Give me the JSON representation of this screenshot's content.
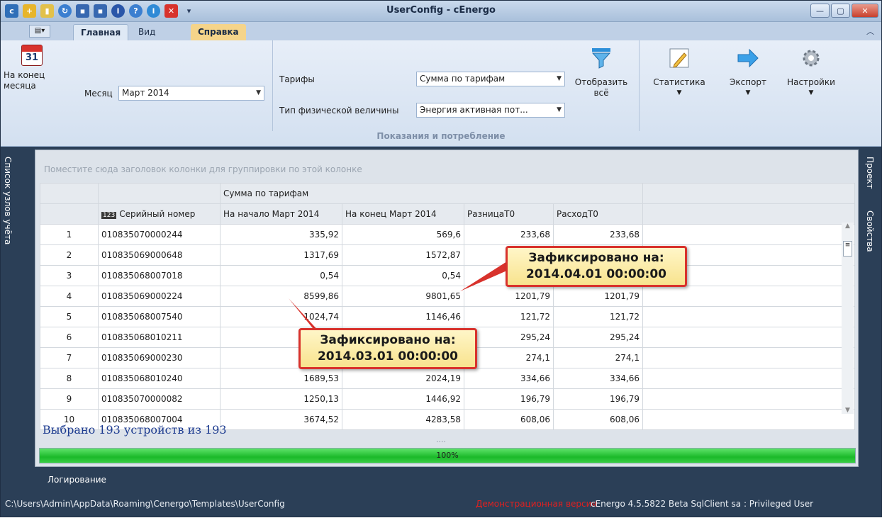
{
  "window": {
    "title": "UserConfig - cEnergo",
    "qat_icons": [
      "app-logo-icon",
      "add-icon",
      "book-icon",
      "refresh-icon",
      "save-icon",
      "save-as-icon",
      "info-icon",
      "help-icon",
      "info-circle-icon",
      "delete-icon",
      "dropdown-icon"
    ]
  },
  "ribbon_tabs": [
    "Главная",
    "Вид",
    "Справка"
  ],
  "ribbon": {
    "end_of_month_label": "На конец\nмесяца",
    "calendar_day": "31",
    "month_label": "Месяц",
    "month_value": "Март 2014",
    "tariffs_label": "Тарифы",
    "tariffs_value": "Сумма по тарифам",
    "phys_type_label": "Тип физической величины",
    "phys_type_value": "Энергия активная пот...",
    "show_all_label": "Отобразить\nвсё",
    "statistics_label": "Статистика",
    "export_label": "Экспорт",
    "settings_label": "Настройки",
    "group_caption": "Показания и потребление"
  },
  "side": {
    "left": "Список узлов учёта",
    "right_project": "Проект",
    "right_props": "Свойства"
  },
  "grid": {
    "group_hint": "Поместите сюда заголовок колонки для группировки по этой колонке",
    "band_header": "Сумма по тарифам",
    "columns": [
      "Серийный номер",
      "На начало Март 2014",
      "На конец Март 2014",
      "РазницаТ0",
      "РасходТ0"
    ],
    "serial_badge": "123",
    "rows": [
      [
        "1",
        "010835070000244",
        "335,92",
        "569,6",
        "233,68",
        "233,68"
      ],
      [
        "2",
        "010835069000648",
        "1317,69",
        "1572,87",
        "",
        ""
      ],
      [
        "3",
        "010835068007018",
        "0,54",
        "0,54",
        "",
        ""
      ],
      [
        "4",
        "010835069000224",
        "8599,86",
        "9801,65",
        "1201,79",
        "1201,79"
      ],
      [
        "5",
        "010835068007540",
        "1024,74",
        "1146,46",
        "121,72",
        "121,72"
      ],
      [
        "6",
        "010835068010211",
        "",
        "",
        "295,24",
        "295,24"
      ],
      [
        "7",
        "010835069000230",
        "",
        "",
        "274,1",
        "274,1"
      ],
      [
        "8",
        "010835068010240",
        "1689,53",
        "2024,19",
        "334,66",
        "334,66"
      ],
      [
        "9",
        "010835070000082",
        "1250,13",
        "1446,92",
        "196,79",
        "196,79"
      ],
      [
        "10",
        "010835068007004",
        "3674,52",
        "4283,58",
        "608,06",
        "608,06"
      ]
    ],
    "selected_summary": "Выбрано 193 устройств из 193",
    "dots": "....",
    "progress_text": "100%",
    "progress_value": 1.0
  },
  "callouts": {
    "end": "Зафиксировано на:\n2014.04.01 00:00:00",
    "start": "Зафиксировано на:\n2014.03.01 00:00:00"
  },
  "statusbar": {
    "log_tab": "Логирование",
    "path": "C:\\Users\\Admin\\AppData\\Roaming\\Cenergo\\Templates\\UserConfig",
    "demo": "Демонстрационная версия",
    "version": "cEnergo 4.5.5822 Beta   SqlClient   sa : Privileged User"
  },
  "colors": {
    "accent": "#2b3f57",
    "progress": "#1bb92a",
    "callout_border": "#d8322c"
  }
}
